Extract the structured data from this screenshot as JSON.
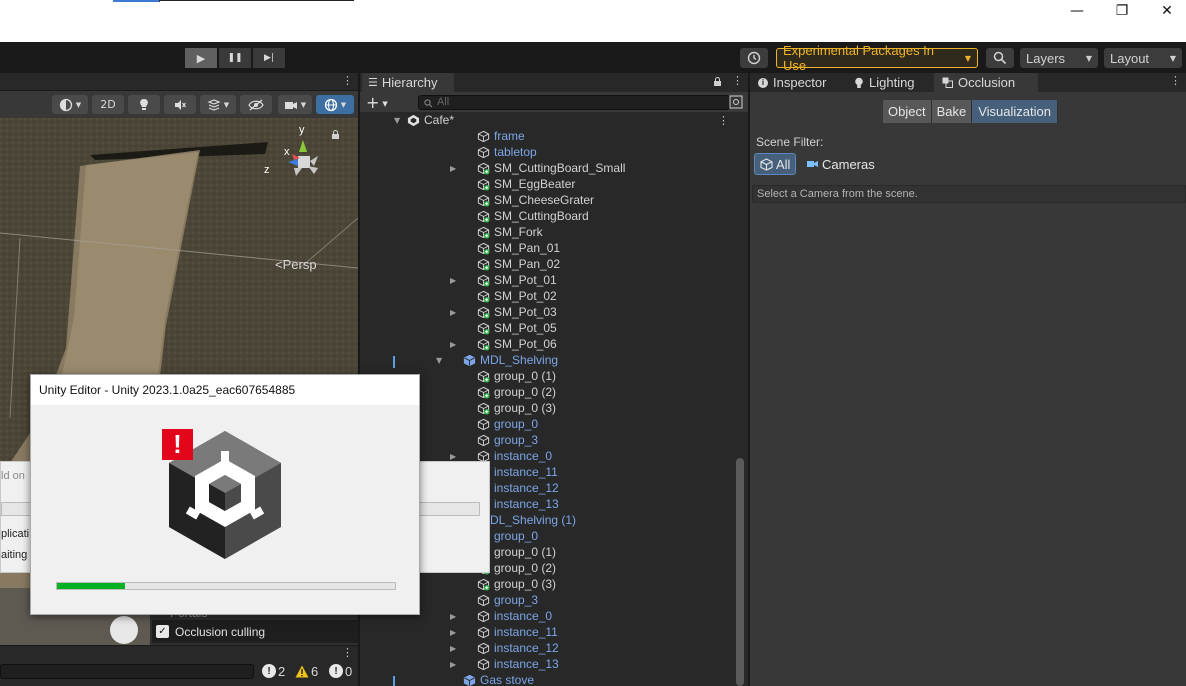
{
  "window": {
    "minimize_glyph": "—",
    "maximize_glyph": "❐",
    "close_glyph": "✕"
  },
  "toolbar": {
    "play_glyph": "▶",
    "pause_glyph": "❚❚",
    "step_glyph": "▶|",
    "experimental_label": "Experimental Packages In Use",
    "layers_label": "Layers",
    "layout_label": "Layout",
    "accent_color": "#f0b429"
  },
  "scene": {
    "mode_2d_label": "2D",
    "persp_label": "<Persp",
    "gizmo_axes": {
      "x": "x",
      "y": "y",
      "z": "z"
    },
    "occlusion_culling_label": "Occlusion culling",
    "occlusion_culling_checked": true,
    "portals_label": "Portals"
  },
  "console": {
    "error_count": "2",
    "warning_count": "6",
    "info_count": "0"
  },
  "hierarchy": {
    "tab_label": "Hierarchy",
    "search_placeholder": "All",
    "scene_name": "Cafe*",
    "rows": [
      {
        "label": "frame",
        "indent": 2,
        "expandable": false,
        "kind": "mesh",
        "color": "blue"
      },
      {
        "label": "tabletop",
        "indent": 2,
        "expandable": false,
        "kind": "mesh",
        "color": "blue"
      },
      {
        "label": "SM_CuttingBoard_Small",
        "indent": 2,
        "expandable": true,
        "kind": "prefab",
        "color": "white"
      },
      {
        "label": "SM_EggBeater",
        "indent": 2,
        "expandable": false,
        "kind": "prefab",
        "color": "white"
      },
      {
        "label": "SM_CheeseGrater",
        "indent": 2,
        "expandable": false,
        "kind": "prefab",
        "color": "white"
      },
      {
        "label": "SM_CuttingBoard",
        "indent": 2,
        "expandable": false,
        "kind": "prefab",
        "color": "white"
      },
      {
        "label": "SM_Fork",
        "indent": 2,
        "expandable": false,
        "kind": "prefab",
        "color": "white"
      },
      {
        "label": "SM_Pan_01",
        "indent": 2,
        "expandable": false,
        "kind": "prefab",
        "color": "white"
      },
      {
        "label": "SM_Pan_02",
        "indent": 2,
        "expandable": false,
        "kind": "prefab",
        "color": "white"
      },
      {
        "label": "SM_Pot_01",
        "indent": 2,
        "expandable": true,
        "kind": "prefab",
        "color": "white"
      },
      {
        "label": "SM_Pot_02",
        "indent": 2,
        "expandable": false,
        "kind": "prefab",
        "color": "white"
      },
      {
        "label": "SM_Pot_03",
        "indent": 2,
        "expandable": true,
        "kind": "prefab",
        "color": "white"
      },
      {
        "label": "SM_Pot_05",
        "indent": 2,
        "expandable": false,
        "kind": "prefab",
        "color": "white"
      },
      {
        "label": "SM_Pot_06",
        "indent": 2,
        "expandable": true,
        "kind": "prefab",
        "color": "white"
      },
      {
        "label": "MDL_Shelving",
        "indent": 1,
        "expandable": true,
        "expanded": true,
        "kind": "model",
        "color": "blue"
      },
      {
        "label": "group_0 (1)",
        "indent": 2,
        "expandable": false,
        "kind": "prefab",
        "color": "white"
      },
      {
        "label": "group_0 (2)",
        "indent": 2,
        "expandable": false,
        "kind": "prefab",
        "color": "white"
      },
      {
        "label": "group_0 (3)",
        "indent": 2,
        "expandable": false,
        "kind": "prefab",
        "color": "white"
      },
      {
        "label": "group_0",
        "indent": 2,
        "expandable": false,
        "kind": "mesh",
        "color": "blue"
      },
      {
        "label": "group_3",
        "indent": 2,
        "expandable": false,
        "kind": "mesh",
        "color": "blue"
      },
      {
        "label": "instance_0",
        "indent": 2,
        "expandable": true,
        "kind": "mesh",
        "color": "blue"
      },
      {
        "label": "instance_11",
        "indent": 2,
        "expandable": true,
        "kind": "mesh",
        "color": "blue"
      },
      {
        "label": "instance_12",
        "indent": 2,
        "expandable": true,
        "kind": "mesh",
        "color": "blue"
      },
      {
        "label": "instance_13",
        "indent": 2,
        "expandable": true,
        "kind": "mesh",
        "color": "blue"
      },
      {
        "label": "MDL_Shelving (1)",
        "indent": 1,
        "expandable": true,
        "expanded": true,
        "kind": "model",
        "color": "blue"
      },
      {
        "label": "group_0",
        "indent": 2,
        "expandable": false,
        "kind": "mesh",
        "color": "blue"
      },
      {
        "label": "group_0 (1)",
        "indent": 2,
        "expandable": false,
        "kind": "prefab",
        "color": "white"
      },
      {
        "label": "group_0 (2)",
        "indent": 2,
        "expandable": false,
        "kind": "prefab",
        "color": "white"
      },
      {
        "label": "group_0 (3)",
        "indent": 2,
        "expandable": false,
        "kind": "prefab",
        "color": "white"
      },
      {
        "label": "group_3",
        "indent": 2,
        "expandable": false,
        "kind": "mesh",
        "color": "blue"
      },
      {
        "label": "instance_0",
        "indent": 2,
        "expandable": true,
        "kind": "mesh",
        "color": "blue"
      },
      {
        "label": "instance_11",
        "indent": 2,
        "expandable": true,
        "kind": "mesh",
        "color": "blue"
      },
      {
        "label": "instance_12",
        "indent": 2,
        "expandable": true,
        "kind": "mesh",
        "color": "blue"
      },
      {
        "label": "instance_13",
        "indent": 2,
        "expandable": true,
        "kind": "mesh",
        "color": "blue"
      },
      {
        "label": "Gas stove",
        "indent": 1,
        "expandable": false,
        "kind": "model",
        "color": "blue"
      }
    ]
  },
  "inspector": {
    "tabs": [
      "Inspector",
      "Lighting",
      "Occlusion"
    ],
    "active_tab": "Occlusion",
    "modes": [
      "Object",
      "Bake",
      "Visualization"
    ],
    "active_mode": "Visualization",
    "scene_filter_label": "Scene Filter:",
    "filter_all_label": "All",
    "filter_cameras_label": "Cameras",
    "hint": "Select a Camera from the scene."
  },
  "dialog": {
    "title": "Unity Editor - Unity 2023.1.0a25_eac607654885",
    "progress": 0.2,
    "progress_color": "#06b025",
    "alert_glyph": "!",
    "bg_text_1": "ld on",
    "bg_text_2": "plicati",
    "bg_text_3": "aiting f"
  }
}
